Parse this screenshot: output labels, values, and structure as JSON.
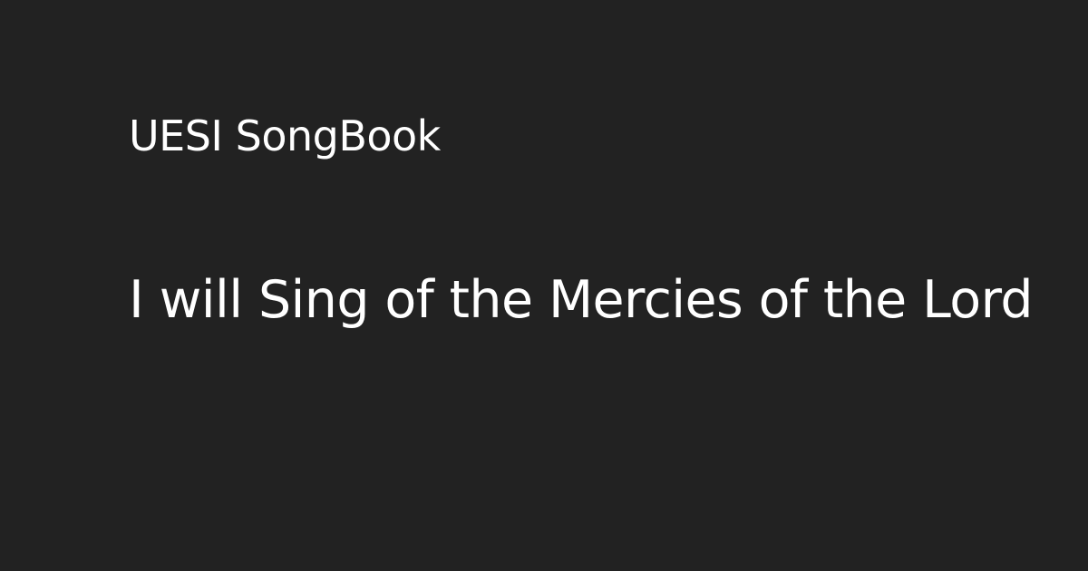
{
  "site_name": "UESI SongBook",
  "song_title": "I will Sing of the Mercies of the Lord",
  "colors": {
    "background": "#222222",
    "text": "#ffffff"
  }
}
